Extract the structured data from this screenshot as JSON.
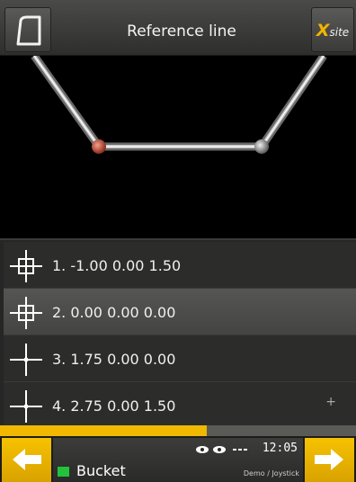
{
  "header": {
    "title": "Reference line",
    "menu_icon": "shape-outline-icon",
    "logo": {
      "x": "X",
      "site": "site"
    }
  },
  "points": [
    {
      "label": "1. -1.00 0.00 1.50",
      "selected": false,
      "icon": "crosshair-icon"
    },
    {
      "label": "2. 0.00 0.00 0.00",
      "selected": true,
      "icon": "crosshair-icon"
    },
    {
      "label": "3. 1.75 0.00 0.00",
      "selected": false,
      "icon": "crosshair-icon"
    },
    {
      "label": "4. 2.75 0.00 1.50",
      "selected": false,
      "icon": "crosshair-icon",
      "extra": "+"
    }
  ],
  "progress": {
    "fraction": 0.58,
    "color": "#f0b800"
  },
  "footer": {
    "time": "12:05",
    "bucket": "Bucket",
    "mode": "Demo / Joystick",
    "back_icon": "arrow-left-icon",
    "next_icon": "arrow-right-icon"
  },
  "colors": {
    "accent": "#f0b800",
    "highlight_point": "#c8503a",
    "bucket_status": "#22c33a"
  }
}
